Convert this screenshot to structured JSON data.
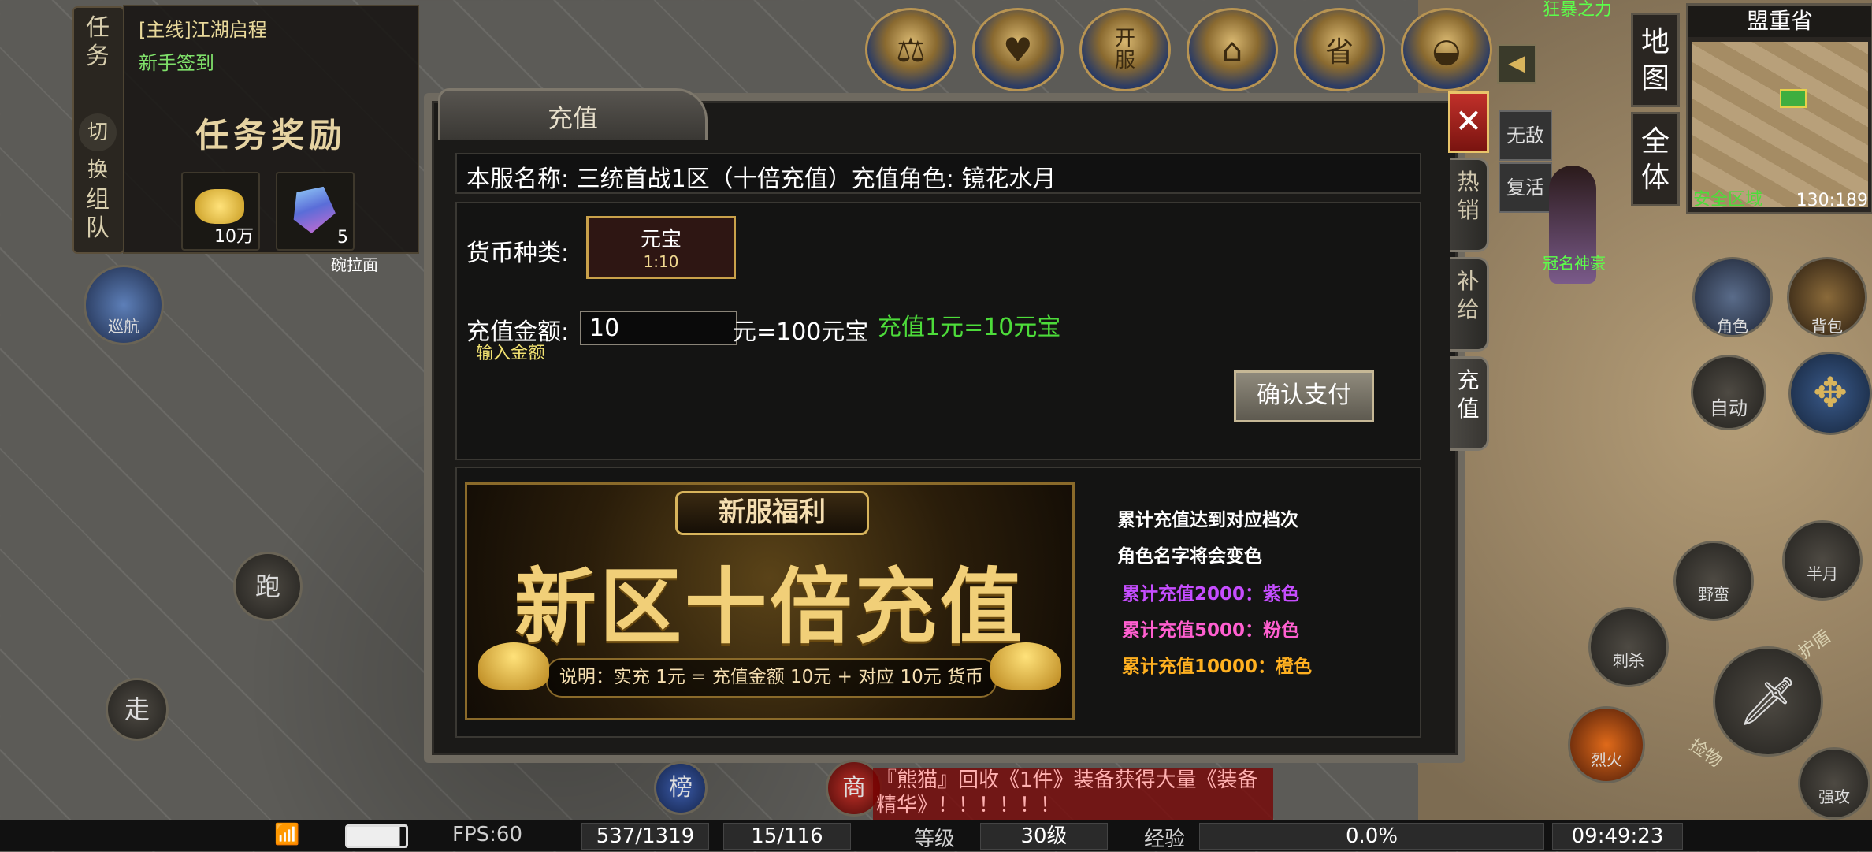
{
  "quest": {
    "tabs": [
      "任\n务",
      "切换",
      "组\n队"
    ],
    "line1": "[主线]江湖启程",
    "line2": "新手签到",
    "reward_title": "任务奖励",
    "items": [
      {
        "icon": "gold-coins-icon",
        "count": "10万"
      },
      {
        "icon": "crystal-icon",
        "count": "5"
      }
    ]
  },
  "left_labels": {
    "cruise": "巡航",
    "run": "跑",
    "walk": "走",
    "wanted": "碗拉面"
  },
  "top_icons": [
    "balance-scales-icon",
    "heart-gem-icon",
    "open-server-scroll-icon",
    "palace-icon",
    "gold-coin-icon",
    "gold-ingot-icon"
  ],
  "top_icon_labels": {
    "open_server": "开\n服",
    "coin": "省"
  },
  "top_right_text": "狂暴之力",
  "dialog": {
    "title": "充值",
    "close": "✕",
    "side_tabs": [
      "热\n销",
      "补\n给",
      "充\n值"
    ],
    "server_info": "本服名称: 三统首战1区（十倍充值）充值角色: 镜花水月",
    "currency_label": "货币种类:",
    "currency_name": "元宝",
    "currency_ratio": "1:10",
    "amount_label": "充值金额:",
    "amount_value": "10",
    "amount_hint": "输入金额",
    "amount_result": "元=100元宝",
    "rate_note": "充值1元=10元宝",
    "confirm": "确认支付"
  },
  "banner": {
    "head": "新服福利",
    "main": "新区十倍充值",
    "note": "说明：实充 1元 = 充值金额 10元 + 对应 10元 货币"
  },
  "tiers": {
    "line1": "累计充值达到对应档次",
    "line2": "角色名字将会变色",
    "purple": "累计充值2000：紫色",
    "pink": "累计充值5000：粉色",
    "orange": "累计充值10000：橙色"
  },
  "colors": {
    "purple": "#c64dff",
    "pink": "#ff5fd0",
    "orange": "#ffb020",
    "green": "#4ddc3a"
  },
  "buffs": {
    "invincible": "无敌",
    "revive": "复活"
  },
  "minimap": {
    "region": "盟重省",
    "zone": "安全区域",
    "coords": "130:189",
    "tab_map": "地\n图",
    "tab_all": "全\n体"
  },
  "player_name": "冠名神豪",
  "right_buttons": {
    "character": "角色",
    "bag": "背包",
    "auto": "自动",
    "skill1": "半月",
    "skill2": "野蛮",
    "skill3": "刺杀",
    "skill4": "烈火",
    "attack": "强攻",
    "guard": "护盾",
    "pick": "捡物"
  },
  "bottom_icons": {
    "rank": "榜",
    "shop": "商"
  },
  "chat_message": "『熊猫』回收《1件》装备获得大量《装备精华》！！！！！！",
  "status": {
    "fps": "FPS:60",
    "hp": "537/1319",
    "mp": "15/116",
    "level_label": "等级",
    "level": "30级",
    "exp_label": "经验",
    "exp": "0.0%",
    "time": "09:49:23"
  }
}
